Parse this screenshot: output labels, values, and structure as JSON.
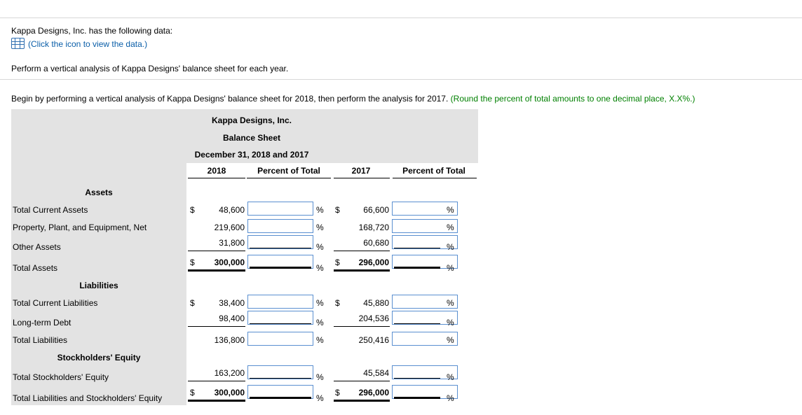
{
  "intro": {
    "line1": "Kappa Designs, Inc. has the following data:",
    "data_link": "(Click the icon to view the data.)",
    "instruction": "Perform a vertical analysis of Kappa Designs' balance sheet for each year."
  },
  "task": {
    "text": "Begin by performing a vertical analysis of Kappa Designs' balance sheet for 2018, then perform the analysis for 2017.",
    "note": "(Round the percent of total amounts to one decimal place, X.X%.)"
  },
  "sheet": {
    "company": "Kappa Designs, Inc.",
    "title": "Balance Sheet",
    "date": "December 31, 2018 and 2017",
    "col_2018": "2018",
    "col_pct1": "Percent of Total",
    "col_2017": "2017",
    "col_pct2": "Percent of Total",
    "dollar": "$",
    "pct": "%",
    "sections": {
      "assets": "Assets",
      "liabilities": "Liabilities",
      "equity": "Stockholders' Equity"
    },
    "rows": [
      {
        "label": "Total Current Assets",
        "v2018": "48,600",
        "v2017": "66,600"
      },
      {
        "label": "Property, Plant, and Equipment, Net",
        "v2018": "219,600",
        "v2017": "168,720"
      },
      {
        "label": "Other Assets",
        "v2018": "31,800",
        "v2017": "60,680"
      },
      {
        "label": "Total Assets",
        "v2018": "300,000",
        "v2017": "296,000"
      },
      {
        "label": "Total Current Liabilities",
        "v2018": "38,400",
        "v2017": "45,880"
      },
      {
        "label": "Long-term Debt",
        "v2018": "98,400",
        "v2017": "204,536"
      },
      {
        "label": "Total Liabilities",
        "v2018": "136,800",
        "v2017": "250,416"
      },
      {
        "label": "Total Stockholders' Equity",
        "v2018": "163,200",
        "v2017": "45,584"
      },
      {
        "label": "Total Liabilities and Stockholders' Equity",
        "v2018": "300,000",
        "v2017": "296,000"
      }
    ]
  }
}
